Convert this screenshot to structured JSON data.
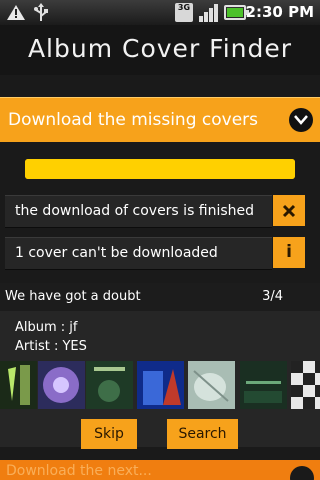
{
  "status_bar": {
    "network_badge": "3G",
    "time": "2:30 PM",
    "icons": [
      "usb-icon",
      "notification-icon",
      "3g-icon",
      "signal-icon",
      "battery-charging-icon"
    ]
  },
  "app": {
    "title": "Album Cover Finder",
    "section": {
      "label": "Download the missing covers"
    },
    "progress": {
      "fraction": 1.0
    },
    "messages": [
      {
        "text": "the download of covers is finished",
        "action_icon": "close-icon"
      },
      {
        "text": "1 cover can't be downloaded",
        "action_icon": "info-icon"
      }
    ],
    "doubt": {
      "heading": "We have got a doubt",
      "counter": "3/4",
      "album_line": "Album : jf",
      "artist_line": "Artist : YES",
      "skip_label": "Skip",
      "search_label": "Search"
    },
    "next_section_label": "Download the next..."
  },
  "colors": {
    "accent": "#f7a21b",
    "progress_fill": "#ffd000",
    "background": "#1a1a1a",
    "panel": "#262626"
  }
}
